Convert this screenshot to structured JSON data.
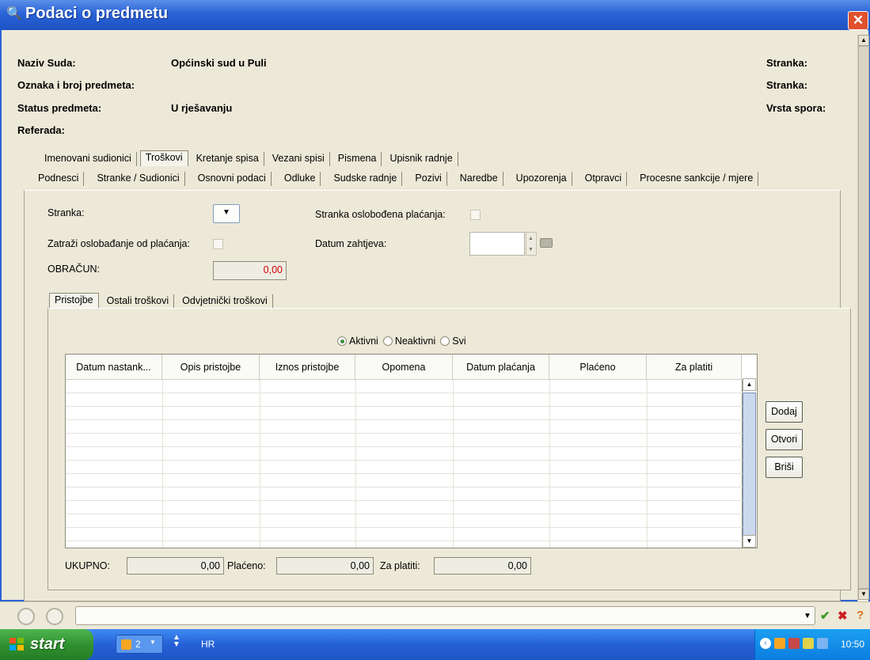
{
  "window": {
    "title": "Podaci o predmetu",
    "close_label": "✕"
  },
  "header": {
    "naziv_suda_label": "Naziv Suda:",
    "naziv_suda_value": "Općinski sud u Puli",
    "oznaka_label": "Oznaka i broj predmeta:",
    "status_label": "Status predmeta:",
    "status_value": "U rješavanju",
    "referada_label": "Referada:",
    "stranka1_label": "Stranka:",
    "stranka2_label": "Stranka:",
    "vrsta_spora_label": "Vrsta spora:"
  },
  "tabs_row1": [
    "Imenovani sudionici",
    "Troškovi",
    "Kretanje spisa",
    "Vezani spisi",
    "Pismena",
    "Upisnik radnje"
  ],
  "tabs_row2": [
    "Podnesci",
    "Stranke / Sudionici",
    "Osnovni podaci",
    "Odluke",
    "Sudske radnje",
    "Pozivi",
    "Naredbe",
    "Upozorenja",
    "Otpravci",
    "Procesne sankcije / mjere"
  ],
  "form": {
    "stranka_label": "Stranka:",
    "stranka_oslobodena_label": "Stranka oslobođena plaćanja:",
    "zatrazi_label": "Zatraži oslobađanje od plaćanja:",
    "datum_zahtjeva_label": "Datum zahtjeva:",
    "obracun_label": "OBRAČUN:",
    "obracun_value": "0,00"
  },
  "subtabs": [
    "Pristojbe",
    "Ostali troškovi",
    "Odvjetnički troškovi"
  ],
  "filter": {
    "options": [
      "Aktivni",
      "Neaktivni",
      "Svi"
    ],
    "selected": "Aktivni"
  },
  "table": {
    "columns": [
      "Datum nastank...",
      "Opis pristojbe",
      "Iznos pristojbe",
      "Opomena",
      "Datum plaćanja",
      "Plaćeno",
      "Za platiti"
    ]
  },
  "buttons": {
    "dodaj": "Dodaj",
    "otvori": "Otvori",
    "brisi": "Briši"
  },
  "totals": {
    "ukupno_label": "UKUPNO:",
    "ukupno_value": "0,00",
    "placeno_label": "Plaćeno:",
    "placeno_value": "0,00",
    "za_platiti_label": "Za platiti:",
    "za_platiti_value": "0,00"
  },
  "taskbar": {
    "start_label": "start",
    "task_count": "2",
    "language": "HR",
    "clock": "10:50"
  },
  "colors": {
    "titlebar": "#2a63d6",
    "obracun_text": "#d40000",
    "taskbar": "#2660d6",
    "start": "#2e8f2e"
  }
}
